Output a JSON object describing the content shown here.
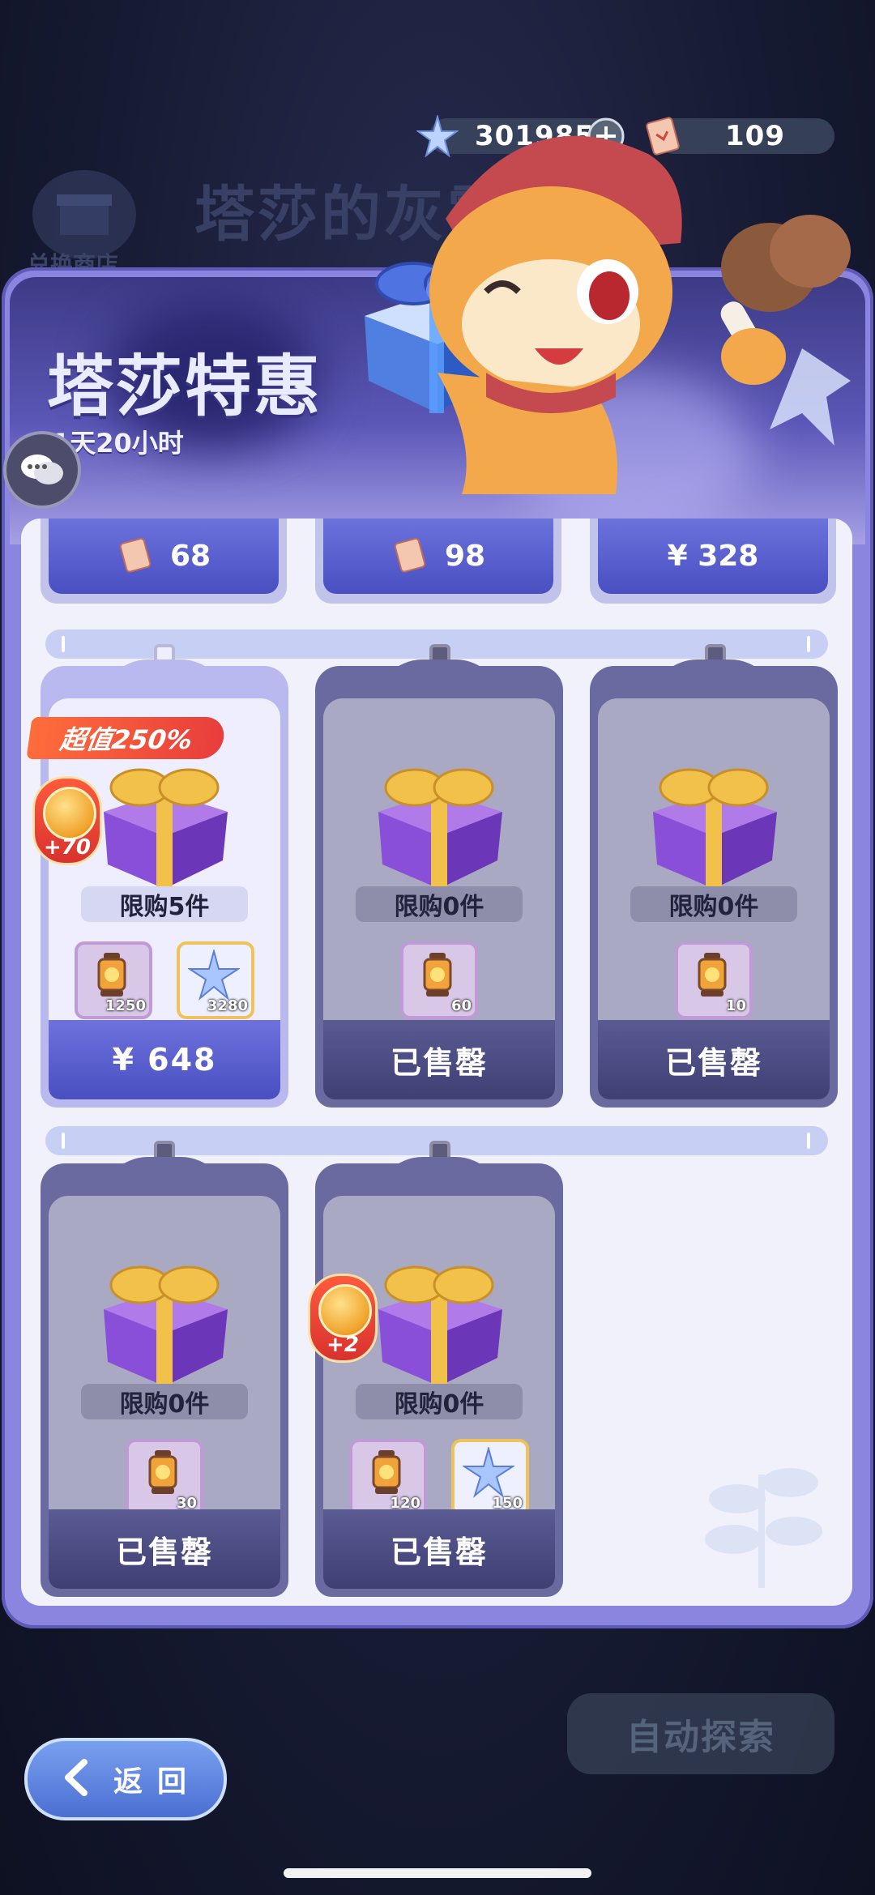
{
  "currencies": {
    "stars": {
      "icon": "star-crystal-icon",
      "value": "301985",
      "add_icon": "plus-icon"
    },
    "tickets": {
      "icon": "ticket-icon",
      "value": "109"
    }
  },
  "background": {
    "title": "塔莎的灰雾",
    "shop_label": "兑换商店"
  },
  "banner": {
    "title": "塔莎特惠",
    "timer": "1天20小时"
  },
  "price_row": [
    {
      "icon": "ticket-icon",
      "price": "68"
    },
    {
      "icon": "ticket-icon",
      "price": "98"
    },
    {
      "icon": "",
      "price": "¥ 328"
    }
  ],
  "products": [
    {
      "active": true,
      "ribbon": "超值250%",
      "bonus": "+70",
      "limit": "限购5件",
      "items": [
        {
          "icon": "lantern-icon",
          "qty": "1250"
        },
        {
          "icon": "star-crystal-icon",
          "qty": "3280"
        }
      ],
      "footer": "¥ 648"
    },
    {
      "active": false,
      "limit": "限购0件",
      "items": [
        {
          "icon": "lantern-icon",
          "qty": "60"
        }
      ],
      "footer": "已售罄"
    },
    {
      "active": false,
      "limit": "限购0件",
      "items": [
        {
          "icon": "lantern-icon",
          "qty": "10"
        }
      ],
      "footer": "已售罄"
    },
    {
      "active": false,
      "limit": "限购0件",
      "items": [
        {
          "icon": "lantern-icon",
          "qty": "30"
        }
      ],
      "footer": "已售罄"
    },
    {
      "active": false,
      "bonus": "+2",
      "limit": "限购0件",
      "items": [
        {
          "icon": "lantern-icon",
          "qty": "120"
        },
        {
          "icon": "star-crystal-icon",
          "qty": "150"
        }
      ],
      "footer": "已售罄"
    }
  ],
  "bottom": {
    "auto_explore": "自动探索",
    "back": "返回"
  },
  "colors": {
    "accent": "#4a4fc1",
    "panel": "#8a86e0",
    "sold_out": "#3f3f74",
    "ribbon": "#e83d3d"
  }
}
